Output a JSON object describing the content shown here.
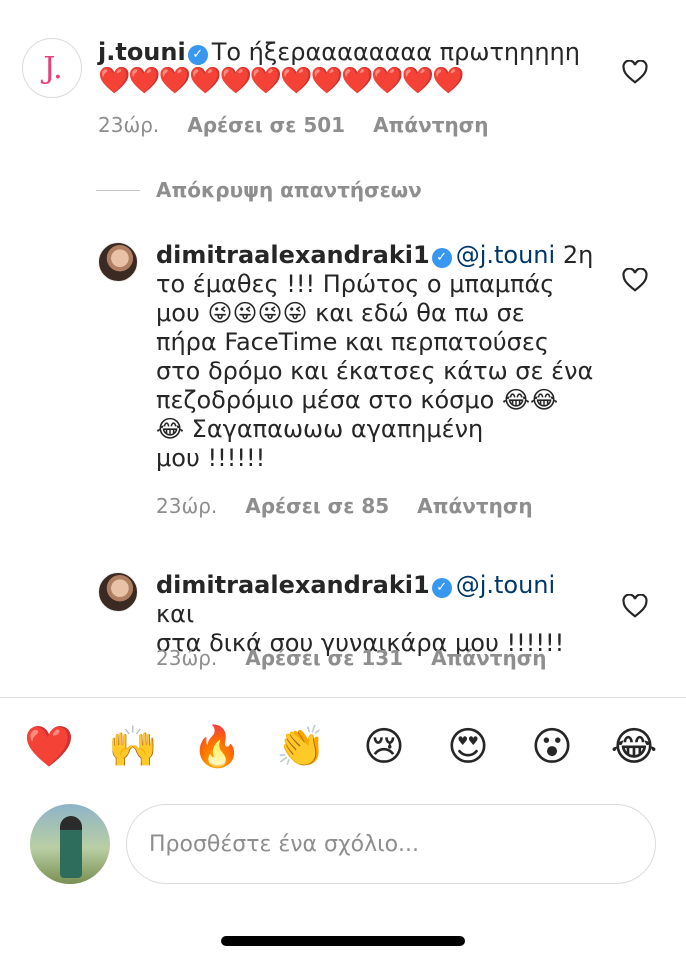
{
  "comments": [
    {
      "username": "j.touni",
      "avatar_letter": "J.",
      "text": "Το ήξεραααααααα πρωτηηηηη",
      "hearts": "❤️❤️❤️❤️❤️❤️❤️❤️❤️❤️❤️❤️",
      "time": "23ώρ.",
      "likes": "Αρέσει σε 501",
      "reply": "Απάντηση"
    },
    {
      "username": "dimitraalexandraki1",
      "mention": "@j.touni",
      "text_first": " 2η",
      "lines": [
        "το έμαθες !!! Πρώτος ο μπαμπάς",
        "μου 😜😜😜😜 και εδώ θα πω σε",
        "πήρα FaceTime και περπατούσες",
        "στο δρόμο και έκατσες κάτω σε ένα",
        "πεζοδρόμιο μέσα στο κόσμο 😂😂",
        "😂 Σαγαπαωωω αγαπημένη",
        "μου !!!!!!"
      ],
      "time": "23ώρ.",
      "likes": "Αρέσει σε 85",
      "reply": "Απάντηση"
    },
    {
      "username": "dimitraalexandraki1",
      "mention": "@j.touni",
      "text_first": " και",
      "lines": [
        "στα δικά σου γυναικάρα μου !!!!!!"
      ],
      "time": "23ώρ.",
      "likes": "Αρέσει σε 131",
      "reply": "Απάντηση"
    }
  ],
  "hide_replies": "Απόκρυψη απαντήσεων",
  "verified_mark": "✓",
  "like_icon": "heart-outline-icon",
  "emoji_bar": [
    "❤️",
    "🙌",
    "🔥",
    "👏",
    "😢",
    "😍",
    "😮",
    "😂"
  ],
  "input": {
    "placeholder": "Προσθέστε ένα σχόλιο..."
  },
  "colors": {
    "verified": "#3897f0",
    "muted": "#8e8e8e",
    "mention": "#00376b",
    "avatar_letter": "#e8417a"
  }
}
